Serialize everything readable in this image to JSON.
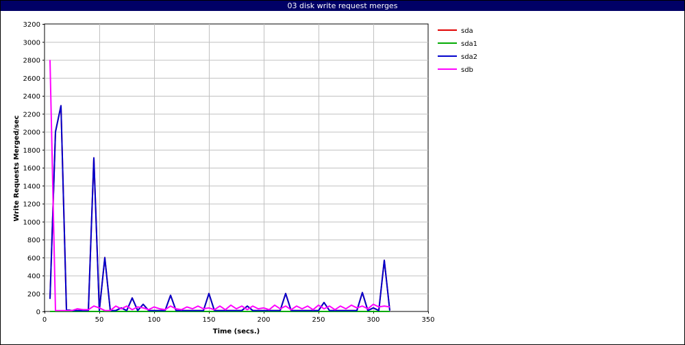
{
  "chart_data": {
    "type": "line",
    "title": "03 disk write request merges",
    "xlabel": "Time (secs.)",
    "ylabel": "Write Requests Merged/sec",
    "xlim": [
      0,
      350
    ],
    "ylim": [
      0,
      3200
    ],
    "xticks": [
      0,
      50,
      100,
      150,
      200,
      250,
      300,
      350
    ],
    "yticks": [
      0,
      200,
      400,
      600,
      800,
      1000,
      1200,
      1400,
      1600,
      1800,
      2000,
      2200,
      2400,
      2600,
      2800,
      3000,
      3200
    ],
    "grid": true,
    "legend_position": "top-right",
    "x": [
      5,
      10,
      15,
      20,
      25,
      30,
      35,
      40,
      45,
      50,
      55,
      60,
      65,
      70,
      75,
      80,
      85,
      90,
      95,
      100,
      105,
      110,
      115,
      120,
      125,
      130,
      135,
      140,
      145,
      150,
      155,
      160,
      165,
      170,
      175,
      180,
      185,
      190,
      195,
      200,
      205,
      210,
      215,
      220,
      225,
      230,
      235,
      240,
      245,
      250,
      255,
      260,
      265,
      270,
      275,
      280,
      285,
      290,
      295,
      300,
      305,
      310,
      315
    ],
    "series": [
      {
        "name": "sda",
        "color": "#e00000",
        "values": [
          140,
          2000,
          2290,
          20,
          10,
          10,
          10,
          10,
          1710,
          10,
          600,
          10,
          10,
          40,
          10,
          150,
          10,
          80,
          10,
          10,
          10,
          10,
          180,
          10,
          10,
          10,
          10,
          10,
          10,
          200,
          10,
          10,
          10,
          10,
          10,
          10,
          60,
          10,
          10,
          10,
          10,
          10,
          10,
          200,
          10,
          10,
          10,
          10,
          10,
          10,
          100,
          10,
          10,
          10,
          10,
          10,
          10,
          210,
          10,
          40,
          10,
          570,
          10
        ]
      },
      {
        "name": "sda1",
        "color": "#00aa00",
        "values": [
          0,
          0,
          0,
          0,
          0,
          0,
          0,
          0,
          0,
          0,
          0,
          0,
          0,
          0,
          0,
          0,
          0,
          0,
          0,
          0,
          0,
          0,
          0,
          0,
          0,
          0,
          0,
          0,
          0,
          0,
          0,
          0,
          0,
          0,
          0,
          0,
          0,
          0,
          0,
          0,
          0,
          0,
          0,
          0,
          0,
          0,
          0,
          0,
          0,
          0,
          0,
          0,
          0,
          0,
          0,
          0,
          0,
          0,
          0,
          0,
          0,
          0,
          0
        ]
      },
      {
        "name": "sda2",
        "color": "#0000cc",
        "values": [
          140,
          2000,
          2290,
          20,
          10,
          10,
          10,
          10,
          1710,
          10,
          600,
          10,
          10,
          40,
          10,
          150,
          10,
          80,
          10,
          10,
          10,
          10,
          180,
          10,
          10,
          10,
          10,
          10,
          10,
          200,
          10,
          10,
          10,
          10,
          10,
          10,
          60,
          10,
          10,
          10,
          10,
          10,
          10,
          200,
          10,
          10,
          10,
          10,
          10,
          10,
          100,
          10,
          10,
          10,
          10,
          10,
          10,
          210,
          10,
          40,
          10,
          570,
          10
        ]
      },
      {
        "name": "sdb",
        "color": "#ff00ff",
        "values": [
          2800,
          10,
          10,
          10,
          10,
          30,
          20,
          20,
          60,
          40,
          10,
          10,
          60,
          30,
          60,
          20,
          50,
          40,
          20,
          50,
          30,
          20,
          60,
          30,
          20,
          50,
          30,
          60,
          30,
          40,
          20,
          60,
          20,
          70,
          30,
          60,
          20,
          60,
          30,
          40,
          20,
          70,
          30,
          60,
          20,
          60,
          30,
          60,
          20,
          70,
          30,
          60,
          20,
          60,
          30,
          70,
          40,
          60,
          30,
          80,
          50,
          60,
          50
        ]
      }
    ]
  }
}
